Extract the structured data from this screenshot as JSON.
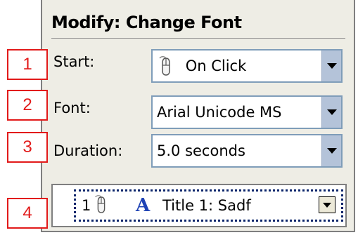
{
  "panel": {
    "title": "Modify: Change Font"
  },
  "fields": {
    "start": {
      "label": "Start:",
      "value": "On Click",
      "icon": "mouse-icon"
    },
    "font": {
      "label": "Font:",
      "value": "Arial Unicode MS"
    },
    "duration": {
      "label": "Duration:",
      "value": "5.0 seconds"
    }
  },
  "animation_list": {
    "items": [
      {
        "number": "1",
        "trigger_icon": "mouse-icon",
        "effect_icon": "font-A-icon",
        "effect_glyph": "A",
        "label": "Title 1: Sadf"
      }
    ]
  },
  "callouts": [
    "1",
    "2",
    "3",
    "4"
  ],
  "colors": {
    "callout": "#e21a1a",
    "panel_bg": "#eeede5",
    "combo_border": "#7f9db9",
    "combo_button": "#b4c3d9",
    "font_icon": "#1f43b5"
  }
}
